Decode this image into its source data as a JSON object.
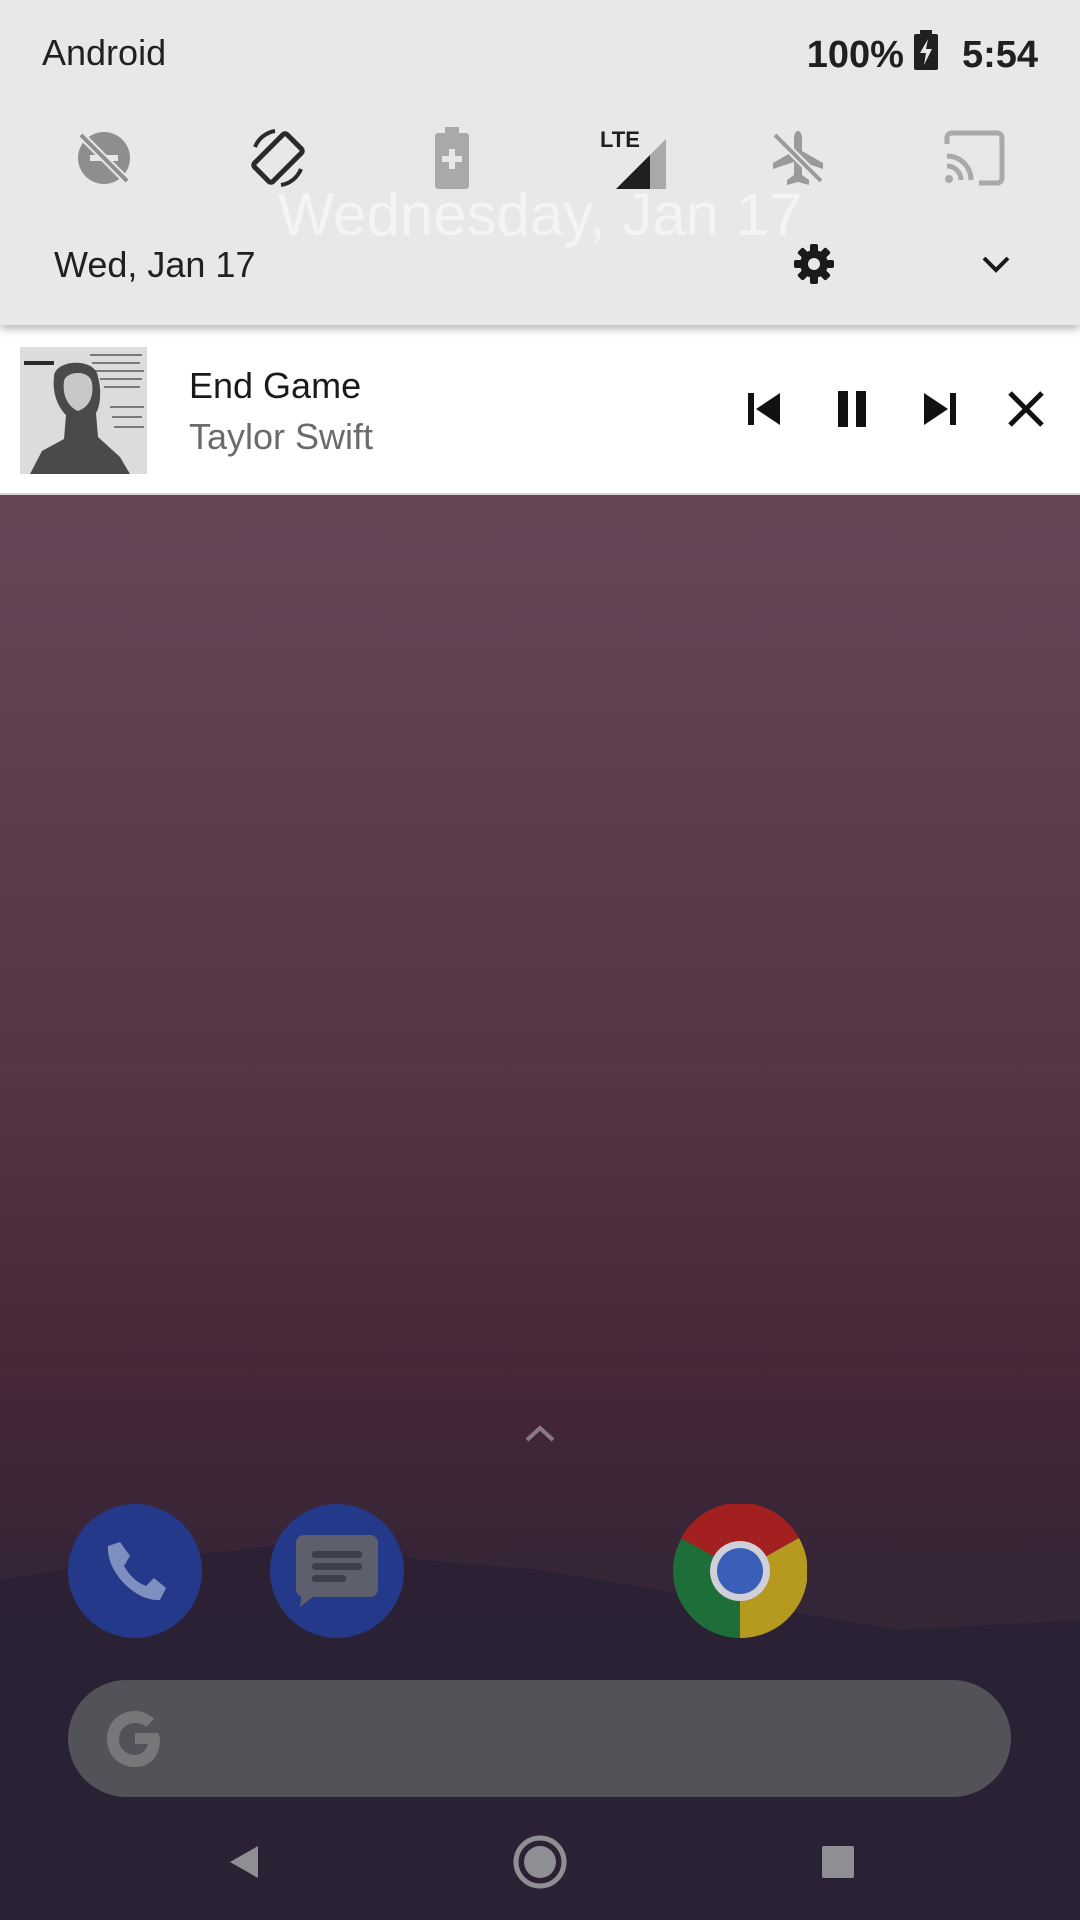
{
  "status_bar": {
    "carrier": "Android",
    "battery_percent": "100%",
    "time": "5:54"
  },
  "quick_settings": {
    "tiles": [
      {
        "name": "do-not-disturb",
        "icon": "do-not-disturb-off-icon"
      },
      {
        "name": "auto-rotate",
        "icon": "screen-rotation-icon"
      },
      {
        "name": "battery-saver",
        "icon": "battery-saver-icon"
      },
      {
        "name": "mobile-data",
        "icon": "lte-signal-icon",
        "label": "LTE"
      },
      {
        "name": "airplane-mode",
        "icon": "airplane-off-icon"
      },
      {
        "name": "cast",
        "icon": "cast-icon"
      }
    ],
    "ghost_date": "Wednesday, Jan 17",
    "date": "Wed, Jan 17"
  },
  "media": {
    "title": "End Game",
    "artist": "Taylor Swift",
    "controls": [
      "skip-previous",
      "pause",
      "skip-next",
      "close"
    ]
  },
  "dock": {
    "apps": [
      "Phone",
      "Messages",
      "Chrome"
    ],
    "search_bar": {
      "placeholder": ""
    }
  },
  "navigation": [
    "back",
    "home",
    "recents"
  ],
  "colors": {
    "shade_bg": "#e8e7e9",
    "wallpaper_top": "#6e4d5e",
    "wallpaper_bottom": "#2e2438",
    "dock_blue": "#25398a",
    "search_bg": "#535258"
  }
}
